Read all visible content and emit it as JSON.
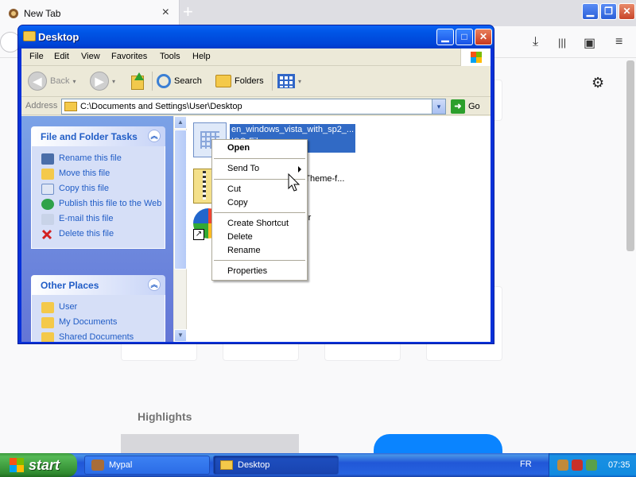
{
  "browser": {
    "tab_title": "New Tab",
    "tab_close": "×",
    "new_tab": "+",
    "min_glyph": "▁",
    "max_glyph": "❐",
    "close_glyph": "✕",
    "highlights_title": "Highlights",
    "icons": {
      "downloads": "⤓",
      "library": "|||",
      "sidebar": "▣",
      "menu": "≡",
      "settings": "⚙"
    }
  },
  "window": {
    "title": "Desktop",
    "min_glyph": "▁",
    "max_glyph": "□",
    "close_glyph": "✕"
  },
  "menubar": {
    "items": [
      "File",
      "Edit",
      "View",
      "Favorites",
      "Tools",
      "Help"
    ]
  },
  "toolbar": {
    "back_label": "Back",
    "back_glyph": "◀",
    "forward_glyph": "▶",
    "dropdown_glyph": "▾",
    "search_label": "Search",
    "folders_label": "Folders"
  },
  "address": {
    "label": "Address",
    "path": "C:\\Documents and Settings\\User\\Desktop",
    "go_label": "Go",
    "go_glyph": "➜",
    "dropdown_glyph": "▾"
  },
  "taskpane": {
    "collapse_glyph": "︽",
    "file_tasks": {
      "title": "File and Folder Tasks",
      "items": [
        "Rename this file",
        "Move this file",
        "Copy this file",
        "Publish this file to the Web",
        "E-mail this file",
        "Delete this file"
      ]
    },
    "other_places": {
      "title": "Other Places",
      "items": [
        "User",
        "My Documents",
        "Shared Documents"
      ]
    }
  },
  "scrollbar": {
    "up_glyph": "▲",
    "down_glyph": "▼"
  },
  "files": [
    {
      "name": "en_windows_vista_with_sp2_...",
      "type": "ISO File"
    },
    {
      "name": "sh-Theme-f...",
      "type": ""
    },
    {
      "name": "ver",
      "type": ""
    }
  ],
  "context_menu": {
    "open": "Open",
    "send_to": "Send To",
    "cut": "Cut",
    "copy": "Copy",
    "create_shortcut": "Create Shortcut",
    "delete": "Delete",
    "rename": "Rename",
    "properties": "Properties"
  },
  "taskbar": {
    "start_label": "start",
    "buttons": [
      {
        "label": "Mypal"
      },
      {
        "label": "Desktop"
      }
    ],
    "language": "FR",
    "clock": "07:35"
  },
  "colors": {
    "xp_blue": "#0055e6",
    "selection": "#316ac5",
    "taskpane_link": "#215dc6",
    "start_green": "#3c9a3c"
  }
}
